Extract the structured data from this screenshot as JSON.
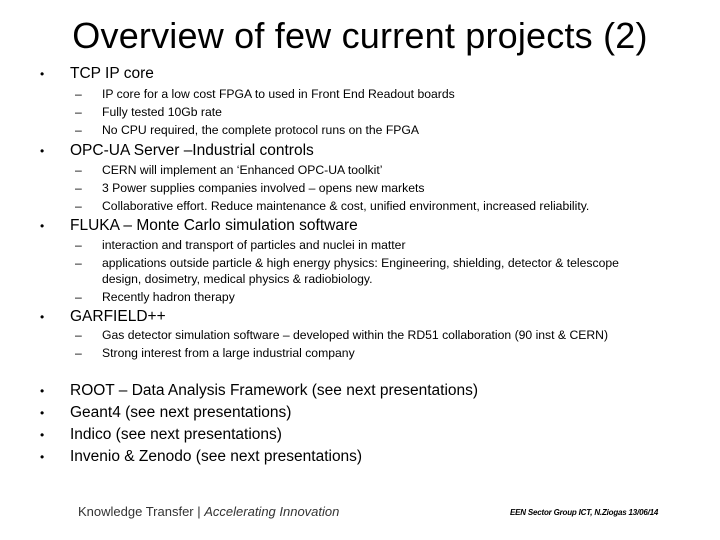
{
  "slide": {
    "title": "Overview of few current projects (2)",
    "bullet_glyph": "•",
    "dash_glyph": "–",
    "sections": [
      {
        "heading": "TCP IP core",
        "items": [
          "IP core for a low cost FPGA to used in Front End Readout boards",
          "Fully tested 10Gb rate",
          "No CPU required, the complete protocol runs on the FPGA"
        ]
      },
      {
        "heading": "OPC-UA Server –Industrial controls",
        "items": [
          "CERN will implement an ‘Enhanced OPC-UA toolkit’",
          "3 Power supplies companies involved – opens new markets",
          "Collaborative effort. Reduce maintenance & cost, unified environment, increased reliability."
        ]
      },
      {
        "heading": "FLUKA – Monte Carlo simulation software",
        "items": [
          "interaction and transport of particles and nuclei in matter",
          "applications outside particle & high energy physics: Engineering, shielding, detector & telescope design, dosimetry, medical physics & radiobiology.",
          "Recently hadron therapy"
        ]
      },
      {
        "heading": "GARFIELD++",
        "items": [
          "Gas detector simulation software – developed within the RD51 collaboration (90 inst & CERN)",
          "Strong interest from a large industrial company"
        ]
      }
    ],
    "other_projects": [
      "ROOT – Data Analysis Framework (see next presentations)",
      "Geant4 (see next presentations)",
      "Indico (see next presentations)",
      "Invenio & Zenodo (see next presentations)"
    ]
  },
  "footer": {
    "brand": "Knowledge Transfer | ",
    "tagline": "Accelerating Innovation",
    "credit": "EEN Sector Group ICT, N.Ziogas 13/06/14"
  }
}
